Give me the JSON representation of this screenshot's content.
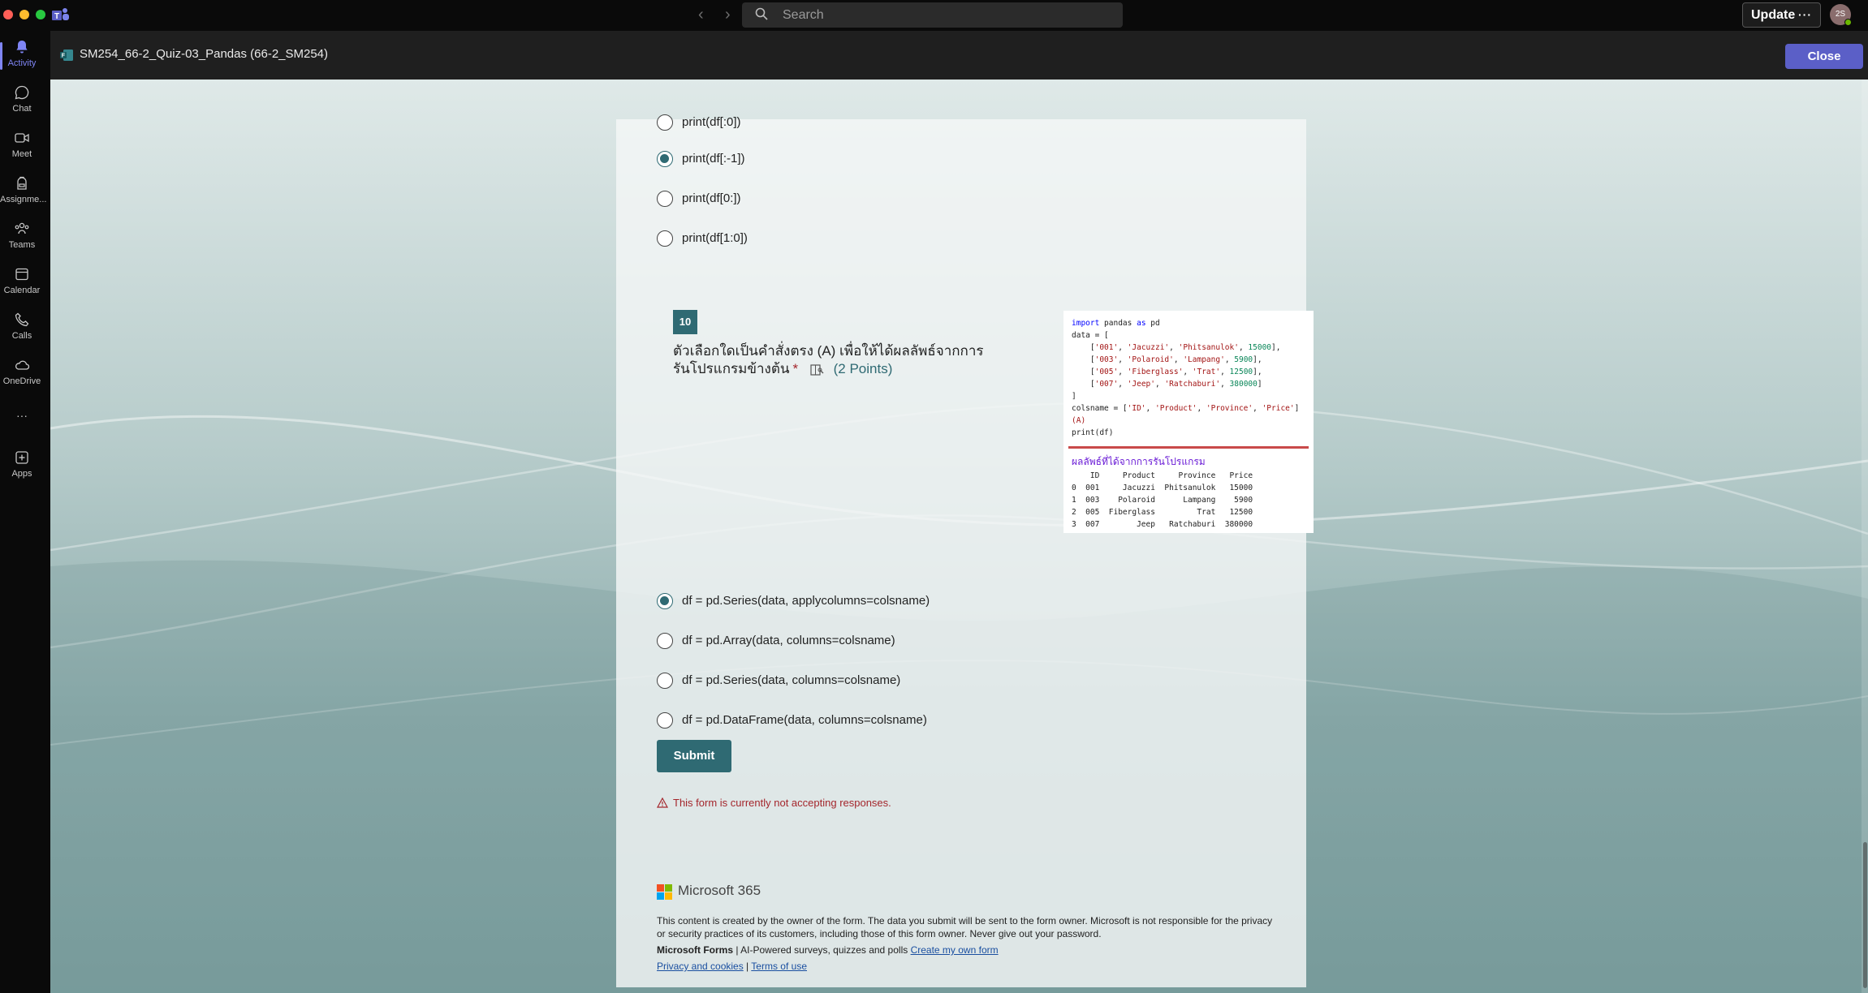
{
  "topbar": {
    "search_placeholder": "Search",
    "update_label": "Update",
    "update_more": "···",
    "avatar_initials": "2S"
  },
  "rail": {
    "items": [
      {
        "label": "Activity",
        "icon": "bell-icon"
      },
      {
        "label": "Chat",
        "icon": "chat-icon"
      },
      {
        "label": "Meet",
        "icon": "video-icon"
      },
      {
        "label": "Assignme...",
        "icon": "backpack-icon"
      },
      {
        "label": "Teams",
        "icon": "people-icon"
      },
      {
        "label": "Calendar",
        "icon": "calendar-icon"
      },
      {
        "label": "Calls",
        "icon": "phone-icon"
      },
      {
        "label": "OneDrive",
        "icon": "cloud-icon"
      },
      {
        "label": "···",
        "icon": "more-icon"
      },
      {
        "label": "Apps",
        "icon": "add-app-icon"
      }
    ]
  },
  "header": {
    "title": "SM254_66-2_Quiz-03_Pandas (66-2_SM254)",
    "close_label": "Close"
  },
  "prev_question": {
    "options": [
      "print(df[:0])",
      "print(df[:-1])",
      "print(df[0:])",
      "print(df[1:0])"
    ],
    "selected_index": 1
  },
  "question10": {
    "number": "10",
    "text": "ตัวเลือกใดเป็นคำสั่งตรง (A) เพื่อให้ได้ผลลัพธ์จากการรันโปรแกรมข้างต้น",
    "required_mark": "*",
    "points": "(2 Points)",
    "image": {
      "output_title": "ผลลัพธ์ที่ได้จากการรันโปรแกรม"
    },
    "options": [
      "df = pd.Series(data, applycolumns=colsname)",
      "df = pd.Array(data, columns=colsname)",
      "df = pd.Series(data, columns=colsname)",
      "df = pd.DataFrame(data, columns=colsname)"
    ],
    "selected_index": 0
  },
  "form": {
    "submit_label": "Submit",
    "warning": "This form is currently not accepting responses."
  },
  "footer": {
    "brand": "Microsoft 365",
    "disclaimer": "This content is created by the owner of the form. The data you submit will be sent to the form owner. Microsoft is not responsible for the privacy or security practices of its customers, including those of this form owner. Never give out your password.",
    "forms_brand": "Microsoft Forms",
    "forms_tagline": " | AI-Powered surveys, quizzes and polls ",
    "create_link": "Create my own form",
    "privacy_link": "Privacy and cookies",
    "separator": " | ",
    "terms_link": "Terms of use"
  },
  "colors": {
    "accent": "#2f6a73",
    "teams_purple": "#5b5fc7",
    "warning_red": "#a4262c"
  }
}
